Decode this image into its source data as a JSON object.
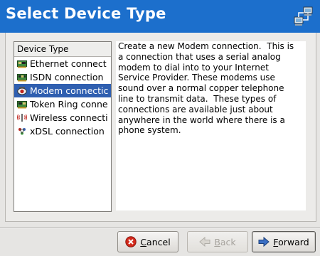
{
  "window": {
    "title": "Select Device Type",
    "header_bg": "#1c6fcc",
    "header_icon": "network-devices-icon"
  },
  "device_list": {
    "header": "Device Type",
    "selected_index": 2,
    "selection_color": "#2f5fb0",
    "items": [
      {
        "label": "Ethernet connect",
        "icon": "ethernet-card-icon"
      },
      {
        "label": "ISDN connection",
        "icon": "isdn-card-icon"
      },
      {
        "label": "Modem connectic",
        "icon": "modem-icon"
      },
      {
        "label": "Token Ring conne",
        "icon": "token-ring-card-icon"
      },
      {
        "label": "Wireless connecti",
        "icon": "wireless-icon"
      },
      {
        "label": "xDSL connection",
        "icon": "xdsl-icon"
      }
    ]
  },
  "description": {
    "text": "Create a new Modem connection.  This is\na connection that uses a serial analog\nmodem to dial into to your Internet\nService Provider. These modems use\nsound over a normal copper telephone\nline to transmit data.  These types of\nconnections are available just about\nanywhere in the world where there is a\nphone system."
  },
  "buttons": {
    "cancel": {
      "mnemonic": "C",
      "rest": "ancel",
      "icon": "cancel-icon"
    },
    "back": {
      "mnemonic": "B",
      "rest": "ack",
      "icon": "back-arrow-icon",
      "disabled": true
    },
    "forward": {
      "mnemonic": "F",
      "rest": "orward",
      "icon": "forward-arrow-icon"
    }
  }
}
